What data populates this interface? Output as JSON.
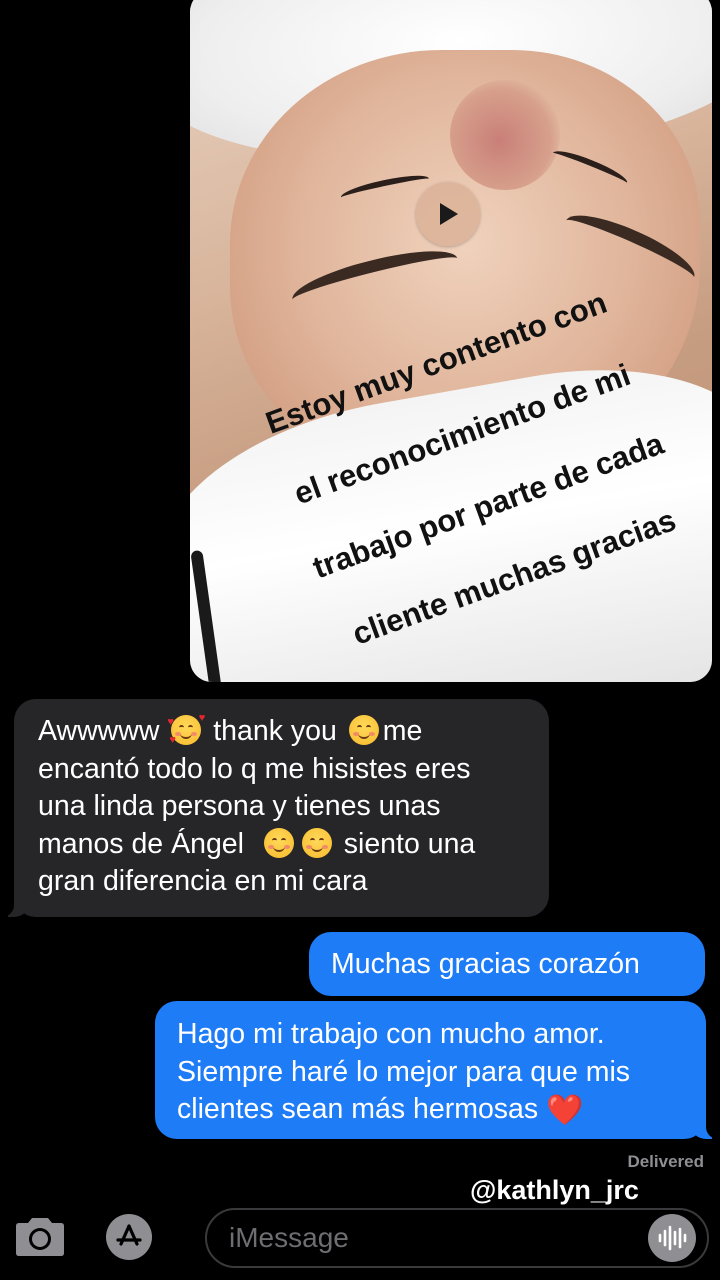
{
  "media": {
    "caption_lines": [
      "Estoy muy contento con",
      "el reconocimiento de mi",
      "trabajo por parte de cada",
      "cliente muchas gracias"
    ],
    "play_icon": "play-icon"
  },
  "incoming_message": {
    "line1_a": "Awwwww",
    "line1_b": "thank you",
    "line1_c": "me",
    "line2": "encantó todo lo q me hisistes eres",
    "line3": "una linda persona y tienes unas",
    "line4_a": "manos de Ángel",
    "line4_b": "siento una",
    "line5": "gran diferencia en mi cara",
    "emojis": [
      "smiling-face-with-hearts",
      "smiling-face",
      "smiling-face",
      "smiling-face"
    ]
  },
  "outgoing_messages": {
    "message1": "Muchas gracias corazón",
    "message2_line1": "Hago mi trabajo con mucho amor.",
    "message2_line2": "Siempre haré lo mejor para que mis",
    "message2_line3": "clientes sean más hermosas",
    "message2_emoji": "❤️"
  },
  "status": {
    "delivered": "Delivered"
  },
  "watermark": "@kathlyn_jrc",
  "input_bar": {
    "placeholder": "iMessage",
    "camera_icon": "camera-icon",
    "appstore_icon": "app-store-icon",
    "audio_icon": "audio-waveform-icon"
  },
  "colors": {
    "background": "#000000",
    "incoming_bubble": "#262628",
    "outgoing_bubble": "#1f7cf7",
    "delivered_text": "#8e8e93"
  }
}
